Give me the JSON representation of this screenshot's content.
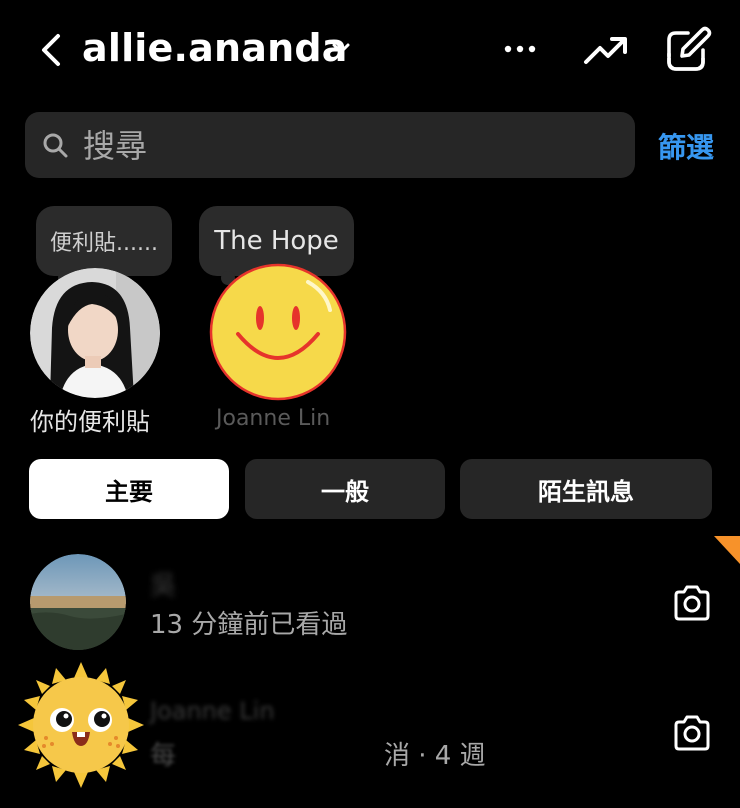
{
  "header": {
    "username": "allie.ananda",
    "icons": [
      "back-arrow-icon",
      "chevron-down-icon",
      "more-icon",
      "trending-icon",
      "new-message-icon"
    ]
  },
  "search": {
    "placeholder": "搜尋",
    "filter_label": "篩選"
  },
  "notes": [
    {
      "bubble": "便利貼......",
      "label": "你的便利貼"
    },
    {
      "bubble": "The Hope",
      "label": "Joanne Lin"
    }
  ],
  "tabs": [
    {
      "label": "主要",
      "selected": true
    },
    {
      "label": "一般",
      "selected": false
    },
    {
      "label": "陌生訊息",
      "selected": false
    }
  ],
  "conversations": [
    {
      "name": "吳",
      "status": "13 分鐘前已看過"
    },
    {
      "name": "Joanne Lin",
      "status_prefix": "每",
      "status_suffix": "消 · 4 週"
    }
  ],
  "colors": {
    "accent": "#3797f0",
    "background": "#000000",
    "surface": "#262626",
    "corner": "#f7922a"
  }
}
